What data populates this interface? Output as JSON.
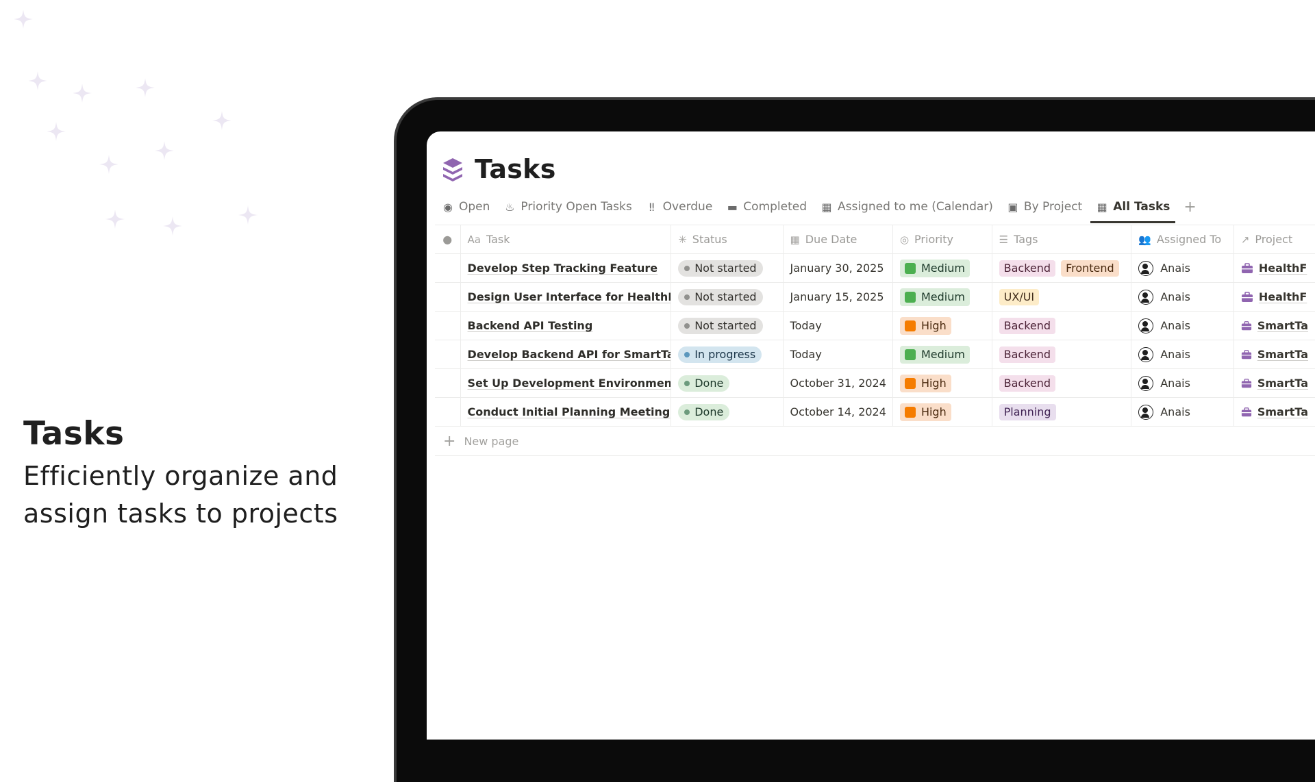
{
  "promo": {
    "title": "Tasks",
    "subtitle": "Efficiently organize and assign tasks to projects"
  },
  "app": {
    "title": "Tasks",
    "icon": "stack-icon",
    "accent": "#9065b0"
  },
  "views": [
    {
      "label": "Open",
      "icon": "circle-icon"
    },
    {
      "label": "Priority Open Tasks",
      "icon": "fire-icon"
    },
    {
      "label": "Overdue",
      "icon": "double-exclamation-icon"
    },
    {
      "label": "Completed",
      "icon": "archive-icon"
    },
    {
      "label": "Assigned to me (Calendar)",
      "icon": "calendar-icon"
    },
    {
      "label": "By Project",
      "icon": "briefcase-icon"
    },
    {
      "label": "All Tasks",
      "icon": "table-icon",
      "active": true
    }
  ],
  "table": {
    "columns": [
      {
        "label": "Task",
        "prefix": "Aa"
      },
      {
        "label": "Status",
        "icon": "status-icon"
      },
      {
        "label": "Due Date",
        "icon": "calendar-icon"
      },
      {
        "label": "Priority",
        "icon": "target-icon"
      },
      {
        "label": "Tags",
        "icon": "list-icon"
      },
      {
        "label": "Assigned To",
        "icon": "people-icon"
      },
      {
        "label": "Project",
        "icon": "relation-arrow-icon"
      }
    ],
    "rows": [
      {
        "task": "Develop Step Tracking Feature",
        "status": "Not started",
        "due": "January 30, 2025",
        "priority": "Medium",
        "tags": [
          "Backend",
          "Frontend"
        ],
        "assignee": "Anais",
        "project": "HealthF"
      },
      {
        "task": "Design User Interface for HealthFit",
        "status": "Not started",
        "due": "January 15, 2025",
        "priority": "Medium",
        "tags": [
          "UX/UI"
        ],
        "assignee": "Anais",
        "project": "HealthF"
      },
      {
        "task": "Backend API Testing",
        "status": "Not started",
        "due": "Today",
        "priority": "High",
        "tags": [
          "Backend"
        ],
        "assignee": "Anais",
        "project": "SmartTa"
      },
      {
        "task": "Develop Backend API for SmartTask",
        "status": "In progress",
        "due": "Today",
        "priority": "Medium",
        "tags": [
          "Backend"
        ],
        "assignee": "Anais",
        "project": "SmartTa"
      },
      {
        "task": "Set Up Development Environment",
        "status": "Done",
        "due": "October 31, 2024",
        "priority": "High",
        "tags": [
          "Backend"
        ],
        "assignee": "Anais",
        "project": "SmartTa"
      },
      {
        "task": "Conduct Initial Planning Meeting",
        "status": "Done",
        "due": "October 14, 2024",
        "priority": "High",
        "tags": [
          "Planning"
        ],
        "assignee": "Anais",
        "project": "SmartTa"
      }
    ],
    "new_page_label": "New page"
  },
  "colors": {
    "status": {
      "Not started": {
        "bg": "#e3e2e0",
        "dot": "#91918e",
        "fg": "#32302c"
      },
      "In progress": {
        "bg": "#d3e5ef",
        "dot": "#5b97bd",
        "fg": "#183347"
      },
      "Done": {
        "bg": "#dbeddb",
        "dot": "#6c9b7d",
        "fg": "#1c3829"
      }
    },
    "priority": {
      "Medium": {
        "bg": "#dbeddb",
        "sq": "#4caf50",
        "fg": "#1c3829"
      },
      "High": {
        "bg": "#fadec9",
        "sq": "#f57c00",
        "fg": "#49290e"
      }
    },
    "tags": {
      "Backend": {
        "bg": "#f4dfeb",
        "fg": "#4c2337"
      },
      "Frontend": {
        "bg": "#fadec9",
        "fg": "#49290e"
      },
      "UX/UI": {
        "bg": "#fdecc8",
        "fg": "#402c1b"
      },
      "Planning": {
        "bg": "#e8deee",
        "fg": "#412454"
      }
    }
  }
}
